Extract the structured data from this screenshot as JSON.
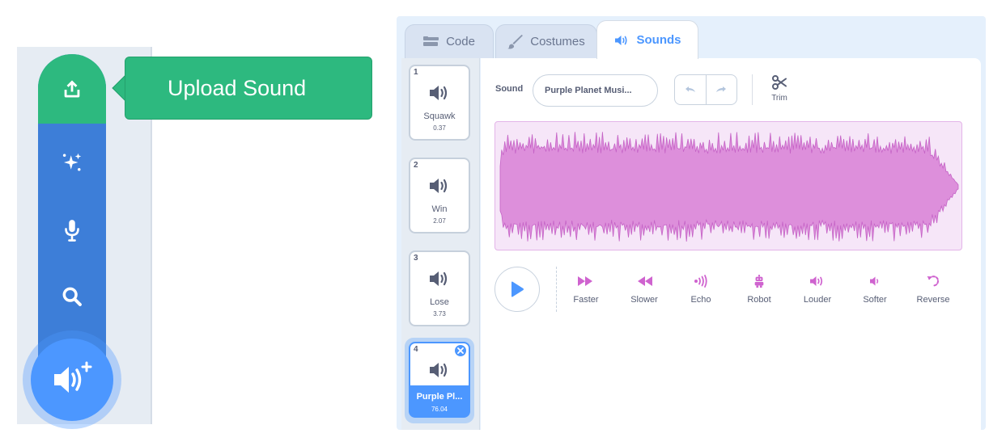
{
  "tooltip": {
    "text": "Upload Sound"
  },
  "sound_menu": {
    "items": [
      {
        "name": "upload",
        "icon": "upload-icon"
      },
      {
        "name": "surprise",
        "icon": "sparkle-icon"
      },
      {
        "name": "record",
        "icon": "microphone-icon"
      },
      {
        "name": "choose",
        "icon": "search-icon"
      }
    ],
    "add_button_icon": "add-sound-icon"
  },
  "tabs": [
    {
      "label": "Code",
      "icon": "code-icon"
    },
    {
      "label": "Costumes",
      "icon": "brush-icon"
    },
    {
      "label": "Sounds",
      "icon": "speaker-icon",
      "active": true
    }
  ],
  "sounds": [
    {
      "index": "1",
      "name": "Squawk",
      "duration": "0.37"
    },
    {
      "index": "2",
      "name": "Win",
      "duration": "2.07"
    },
    {
      "index": "3",
      "name": "Lose",
      "duration": "3.73"
    },
    {
      "index": "4",
      "name": "Purple Pl...",
      "duration": "76.04",
      "selected": true
    }
  ],
  "editor": {
    "sound_label": "Sound",
    "sound_name": "Purple Planet Musi...",
    "trim_label": "Trim"
  },
  "effects": [
    {
      "label": "Faster",
      "icon": "faster-icon"
    },
    {
      "label": "Slower",
      "icon": "slower-icon"
    },
    {
      "label": "Echo",
      "icon": "echo-icon"
    },
    {
      "label": "Robot",
      "icon": "robot-icon"
    },
    {
      "label": "Louder",
      "icon": "louder-icon"
    },
    {
      "label": "Softer",
      "icon": "softer-icon"
    },
    {
      "label": "Reverse",
      "icon": "reverse-icon"
    }
  ],
  "colors": {
    "primary": "#4c97ff",
    "menu_blue": "#3d7ed8",
    "upload_green": "#2db97f",
    "sound_magenta": "#cf63cf",
    "waveform_fill": "#dd8fdb",
    "waveform_bg": "#f6e6f8"
  }
}
